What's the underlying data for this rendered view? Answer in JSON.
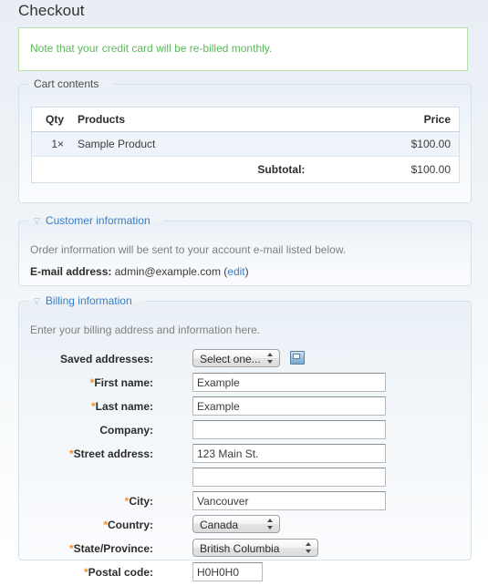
{
  "page": {
    "title": "Checkout"
  },
  "notice": {
    "text": "Note that your credit card will be re-billed monthly."
  },
  "cart": {
    "legend": "Cart contents",
    "columns": {
      "qty": "Qty",
      "products": "Products",
      "price": "Price"
    },
    "rows": [
      {
        "qty": "1×",
        "product": "Sample Product",
        "price": "$100.00"
      }
    ],
    "subtotal_label": "Subtotal:",
    "subtotal_value": "$100.00"
  },
  "customer": {
    "legend": "Customer information",
    "toggle_icon": "triangle-down-icon",
    "description": "Order information will be sent to your account e-mail listed below.",
    "email_label": "E-mail address:",
    "email_value": "admin@example.com",
    "edit_open_paren": "(",
    "edit_link": "edit",
    "edit_close_paren": ")"
  },
  "billing": {
    "legend": "Billing information",
    "toggle_icon": "triangle-down-icon",
    "description": "Enter your billing address and information here.",
    "saved_addresses": {
      "label": "Saved addresses:",
      "selected": "Select one...",
      "icon": "address-book-icon"
    },
    "fields": {
      "first_name": {
        "label": "First name:",
        "required": "*",
        "value": "Example"
      },
      "last_name": {
        "label": "Last name:",
        "required": "*",
        "value": "Example"
      },
      "company": {
        "label": "Company:",
        "required": "",
        "value": ""
      },
      "street_address": {
        "label": "Street address:",
        "required": "*",
        "value": "123 Main St."
      },
      "street_address_2": {
        "label": "",
        "required": "",
        "value": ""
      },
      "city": {
        "label": "City:",
        "required": "*",
        "value": "Vancouver"
      },
      "country": {
        "label": "Country:",
        "required": "*",
        "value": "Canada"
      },
      "state_province": {
        "label": "State/Province:",
        "required": "*",
        "value": "British Columbia"
      },
      "postal_code": {
        "label": "Postal code:",
        "required": "*",
        "value": "H0H0H0"
      }
    }
  },
  "colors": {
    "notice_green": "#5cb85c",
    "link_blue": "#3b7cc4",
    "required_orange": "#f59120",
    "fieldset_border": "#d6e1ea",
    "row_highlight": "#eef4fa"
  }
}
